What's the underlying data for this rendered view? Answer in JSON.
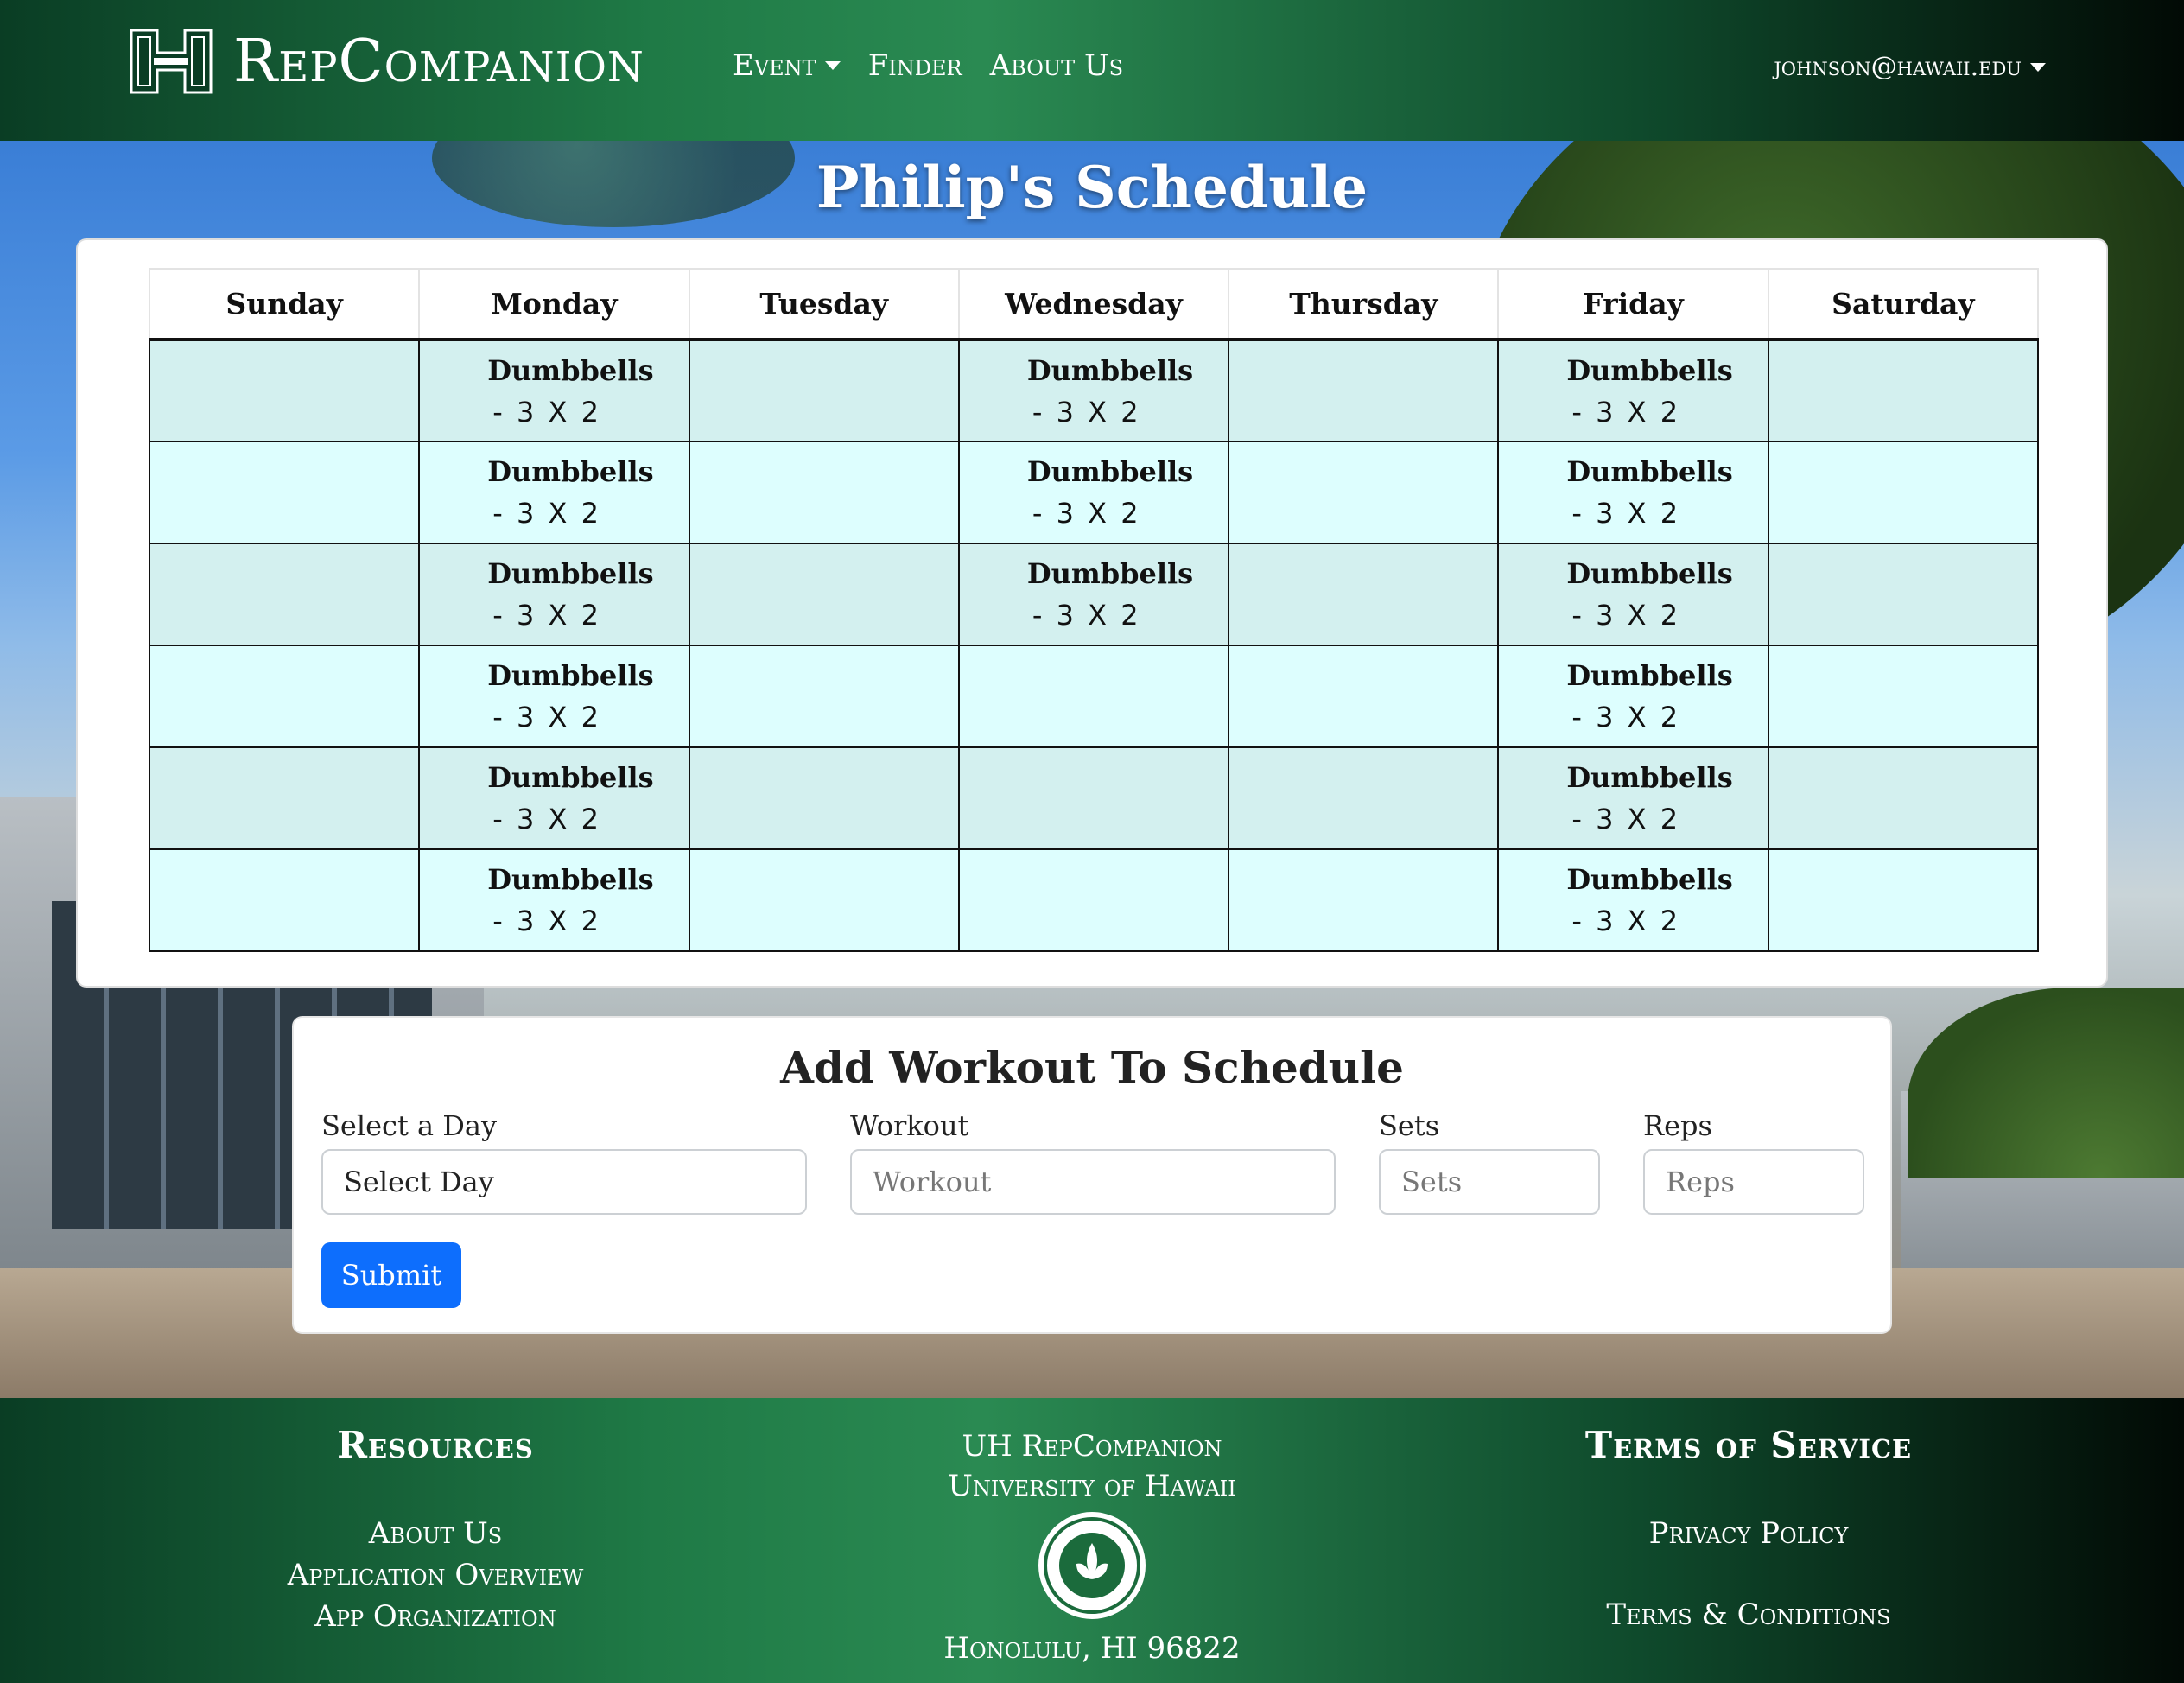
{
  "navbar": {
    "brand": "RepCompanion",
    "links": {
      "event": "Event",
      "finder": "Finder",
      "about": "About Us"
    },
    "user": "johnson@hawaii.edu"
  },
  "schedule": {
    "title": "Philip's Schedule",
    "days": [
      "Sunday",
      "Monday",
      "Tuesday",
      "Wednesday",
      "Thursday",
      "Friday",
      "Saturday"
    ],
    "rows": [
      [
        "",
        "Dumbbells|- 3 X 2",
        "",
        "Dumbbells|- 3 X 2",
        "",
        "Dumbbells|- 3 X 2",
        ""
      ],
      [
        "",
        "Dumbbells|- 3 X 2",
        "",
        "Dumbbells|- 3 X 2",
        "",
        "Dumbbells|- 3 X 2",
        ""
      ],
      [
        "",
        "Dumbbells|- 3 X 2",
        "",
        "Dumbbells|- 3 X 2",
        "",
        "Dumbbells|- 3 X 2",
        ""
      ],
      [
        "",
        "Dumbbells|- 3 X 2",
        "",
        "",
        "",
        "Dumbbells|- 3 X 2",
        ""
      ],
      [
        "",
        "Dumbbells|- 3 X 2",
        "",
        "",
        "",
        "Dumbbells|- 3 X 2",
        ""
      ],
      [
        "",
        "Dumbbells|- 3 X 2",
        "",
        "",
        "",
        "Dumbbells|- 3 X 2",
        ""
      ]
    ]
  },
  "form": {
    "title": "Add Workout To Schedule",
    "day_label": "Select a Day",
    "day_value": "Select Day",
    "workout_label": "Workout",
    "workout_placeholder": "Workout",
    "sets_label": "Sets",
    "sets_placeholder": "Sets",
    "reps_label": "Reps",
    "reps_placeholder": "Reps",
    "submit_label": "Submit"
  },
  "footer": {
    "resources_head": "Resources",
    "resources_links": [
      "About Us",
      "Application Overview",
      "App Organization"
    ],
    "center_line1": "UH RepCompanion",
    "center_line2": "University of Hawaii",
    "center_address": "Honolulu, HI 96822",
    "terms_head": "Terms of Service",
    "privacy": "Privacy Policy",
    "terms": "Terms & Conditions"
  },
  "colors": {
    "brand_green": "#1f7a46",
    "row_odd": "#d3f0ef",
    "row_even": "#ddfefe",
    "submit_blue": "#0d6efd"
  }
}
